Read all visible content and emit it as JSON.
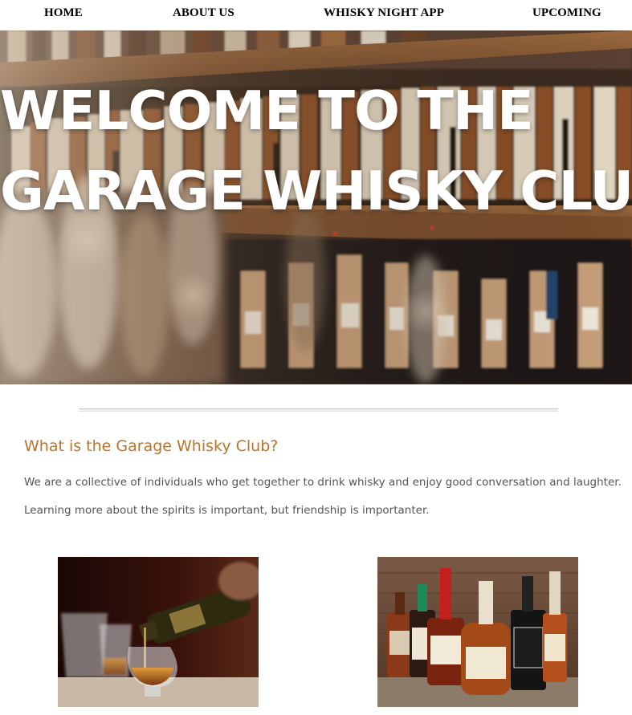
{
  "nav": {
    "items": [
      {
        "label": "HOME"
      },
      {
        "label": "ABOUT US"
      },
      {
        "label": "WHISKY NIGHT APP"
      },
      {
        "label": "UPCOMING"
      }
    ]
  },
  "hero": {
    "title_line1": "WELCOME TO THE",
    "title_line2": "GARAGE WHISKY CLUB"
  },
  "intro": {
    "heading": "What is the Garage Whisky Club?",
    "paragraphs": [
      "We are a collective of individuals who get together to drink whisky and enjoy good conversation and laughter.",
      "Learning more about the spirits is important, but friendship is importanter."
    ]
  },
  "colors": {
    "heading_accent": "#b7752c",
    "body_text": "#555555",
    "nav_text": "#000000",
    "hero_text": "#ffffff"
  }
}
